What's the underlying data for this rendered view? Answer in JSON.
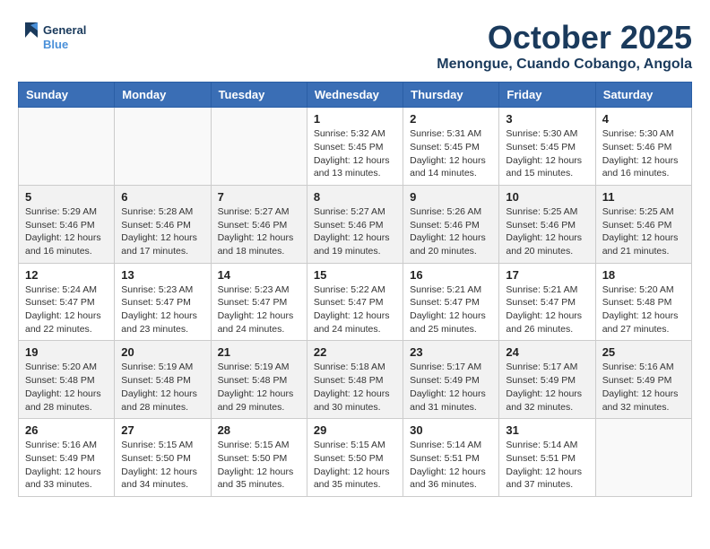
{
  "header": {
    "logo_line1": "General",
    "logo_line2": "Blue",
    "month": "October 2025",
    "location": "Menongue, Cuando Cobango, Angola"
  },
  "weekdays": [
    "Sunday",
    "Monday",
    "Tuesday",
    "Wednesday",
    "Thursday",
    "Friday",
    "Saturday"
  ],
  "weeks": [
    [
      {
        "day": "",
        "sunrise": "",
        "sunset": "",
        "daylight": ""
      },
      {
        "day": "",
        "sunrise": "",
        "sunset": "",
        "daylight": ""
      },
      {
        "day": "",
        "sunrise": "",
        "sunset": "",
        "daylight": ""
      },
      {
        "day": "1",
        "sunrise": "Sunrise: 5:32 AM",
        "sunset": "Sunset: 5:45 PM",
        "daylight": "Daylight: 12 hours and 13 minutes."
      },
      {
        "day": "2",
        "sunrise": "Sunrise: 5:31 AM",
        "sunset": "Sunset: 5:45 PM",
        "daylight": "Daylight: 12 hours and 14 minutes."
      },
      {
        "day": "3",
        "sunrise": "Sunrise: 5:30 AM",
        "sunset": "Sunset: 5:45 PM",
        "daylight": "Daylight: 12 hours and 15 minutes."
      },
      {
        "day": "4",
        "sunrise": "Sunrise: 5:30 AM",
        "sunset": "Sunset: 5:46 PM",
        "daylight": "Daylight: 12 hours and 16 minutes."
      }
    ],
    [
      {
        "day": "5",
        "sunrise": "Sunrise: 5:29 AM",
        "sunset": "Sunset: 5:46 PM",
        "daylight": "Daylight: 12 hours and 16 minutes."
      },
      {
        "day": "6",
        "sunrise": "Sunrise: 5:28 AM",
        "sunset": "Sunset: 5:46 PM",
        "daylight": "Daylight: 12 hours and 17 minutes."
      },
      {
        "day": "7",
        "sunrise": "Sunrise: 5:27 AM",
        "sunset": "Sunset: 5:46 PM",
        "daylight": "Daylight: 12 hours and 18 minutes."
      },
      {
        "day": "8",
        "sunrise": "Sunrise: 5:27 AM",
        "sunset": "Sunset: 5:46 PM",
        "daylight": "Daylight: 12 hours and 19 minutes."
      },
      {
        "day": "9",
        "sunrise": "Sunrise: 5:26 AM",
        "sunset": "Sunset: 5:46 PM",
        "daylight": "Daylight: 12 hours and 20 minutes."
      },
      {
        "day": "10",
        "sunrise": "Sunrise: 5:25 AM",
        "sunset": "Sunset: 5:46 PM",
        "daylight": "Daylight: 12 hours and 20 minutes."
      },
      {
        "day": "11",
        "sunrise": "Sunrise: 5:25 AM",
        "sunset": "Sunset: 5:46 PM",
        "daylight": "Daylight: 12 hours and 21 minutes."
      }
    ],
    [
      {
        "day": "12",
        "sunrise": "Sunrise: 5:24 AM",
        "sunset": "Sunset: 5:47 PM",
        "daylight": "Daylight: 12 hours and 22 minutes."
      },
      {
        "day": "13",
        "sunrise": "Sunrise: 5:23 AM",
        "sunset": "Sunset: 5:47 PM",
        "daylight": "Daylight: 12 hours and 23 minutes."
      },
      {
        "day": "14",
        "sunrise": "Sunrise: 5:23 AM",
        "sunset": "Sunset: 5:47 PM",
        "daylight": "Daylight: 12 hours and 24 minutes."
      },
      {
        "day": "15",
        "sunrise": "Sunrise: 5:22 AM",
        "sunset": "Sunset: 5:47 PM",
        "daylight": "Daylight: 12 hours and 24 minutes."
      },
      {
        "day": "16",
        "sunrise": "Sunrise: 5:21 AM",
        "sunset": "Sunset: 5:47 PM",
        "daylight": "Daylight: 12 hours and 25 minutes."
      },
      {
        "day": "17",
        "sunrise": "Sunrise: 5:21 AM",
        "sunset": "Sunset: 5:47 PM",
        "daylight": "Daylight: 12 hours and 26 minutes."
      },
      {
        "day": "18",
        "sunrise": "Sunrise: 5:20 AM",
        "sunset": "Sunset: 5:48 PM",
        "daylight": "Daylight: 12 hours and 27 minutes."
      }
    ],
    [
      {
        "day": "19",
        "sunrise": "Sunrise: 5:20 AM",
        "sunset": "Sunset: 5:48 PM",
        "daylight": "Daylight: 12 hours and 28 minutes."
      },
      {
        "day": "20",
        "sunrise": "Sunrise: 5:19 AM",
        "sunset": "Sunset: 5:48 PM",
        "daylight": "Daylight: 12 hours and 28 minutes."
      },
      {
        "day": "21",
        "sunrise": "Sunrise: 5:19 AM",
        "sunset": "Sunset: 5:48 PM",
        "daylight": "Daylight: 12 hours and 29 minutes."
      },
      {
        "day": "22",
        "sunrise": "Sunrise: 5:18 AM",
        "sunset": "Sunset: 5:48 PM",
        "daylight": "Daylight: 12 hours and 30 minutes."
      },
      {
        "day": "23",
        "sunrise": "Sunrise: 5:17 AM",
        "sunset": "Sunset: 5:49 PM",
        "daylight": "Daylight: 12 hours and 31 minutes."
      },
      {
        "day": "24",
        "sunrise": "Sunrise: 5:17 AM",
        "sunset": "Sunset: 5:49 PM",
        "daylight": "Daylight: 12 hours and 32 minutes."
      },
      {
        "day": "25",
        "sunrise": "Sunrise: 5:16 AM",
        "sunset": "Sunset: 5:49 PM",
        "daylight": "Daylight: 12 hours and 32 minutes."
      }
    ],
    [
      {
        "day": "26",
        "sunrise": "Sunrise: 5:16 AM",
        "sunset": "Sunset: 5:49 PM",
        "daylight": "Daylight: 12 hours and 33 minutes."
      },
      {
        "day": "27",
        "sunrise": "Sunrise: 5:15 AM",
        "sunset": "Sunset: 5:50 PM",
        "daylight": "Daylight: 12 hours and 34 minutes."
      },
      {
        "day": "28",
        "sunrise": "Sunrise: 5:15 AM",
        "sunset": "Sunset: 5:50 PM",
        "daylight": "Daylight: 12 hours and 35 minutes."
      },
      {
        "day": "29",
        "sunrise": "Sunrise: 5:15 AM",
        "sunset": "Sunset: 5:50 PM",
        "daylight": "Daylight: 12 hours and 35 minutes."
      },
      {
        "day": "30",
        "sunrise": "Sunrise: 5:14 AM",
        "sunset": "Sunset: 5:51 PM",
        "daylight": "Daylight: 12 hours and 36 minutes."
      },
      {
        "day": "31",
        "sunrise": "Sunrise: 5:14 AM",
        "sunset": "Sunset: 5:51 PM",
        "daylight": "Daylight: 12 hours and 37 minutes."
      },
      {
        "day": "",
        "sunrise": "",
        "sunset": "",
        "daylight": ""
      }
    ]
  ]
}
